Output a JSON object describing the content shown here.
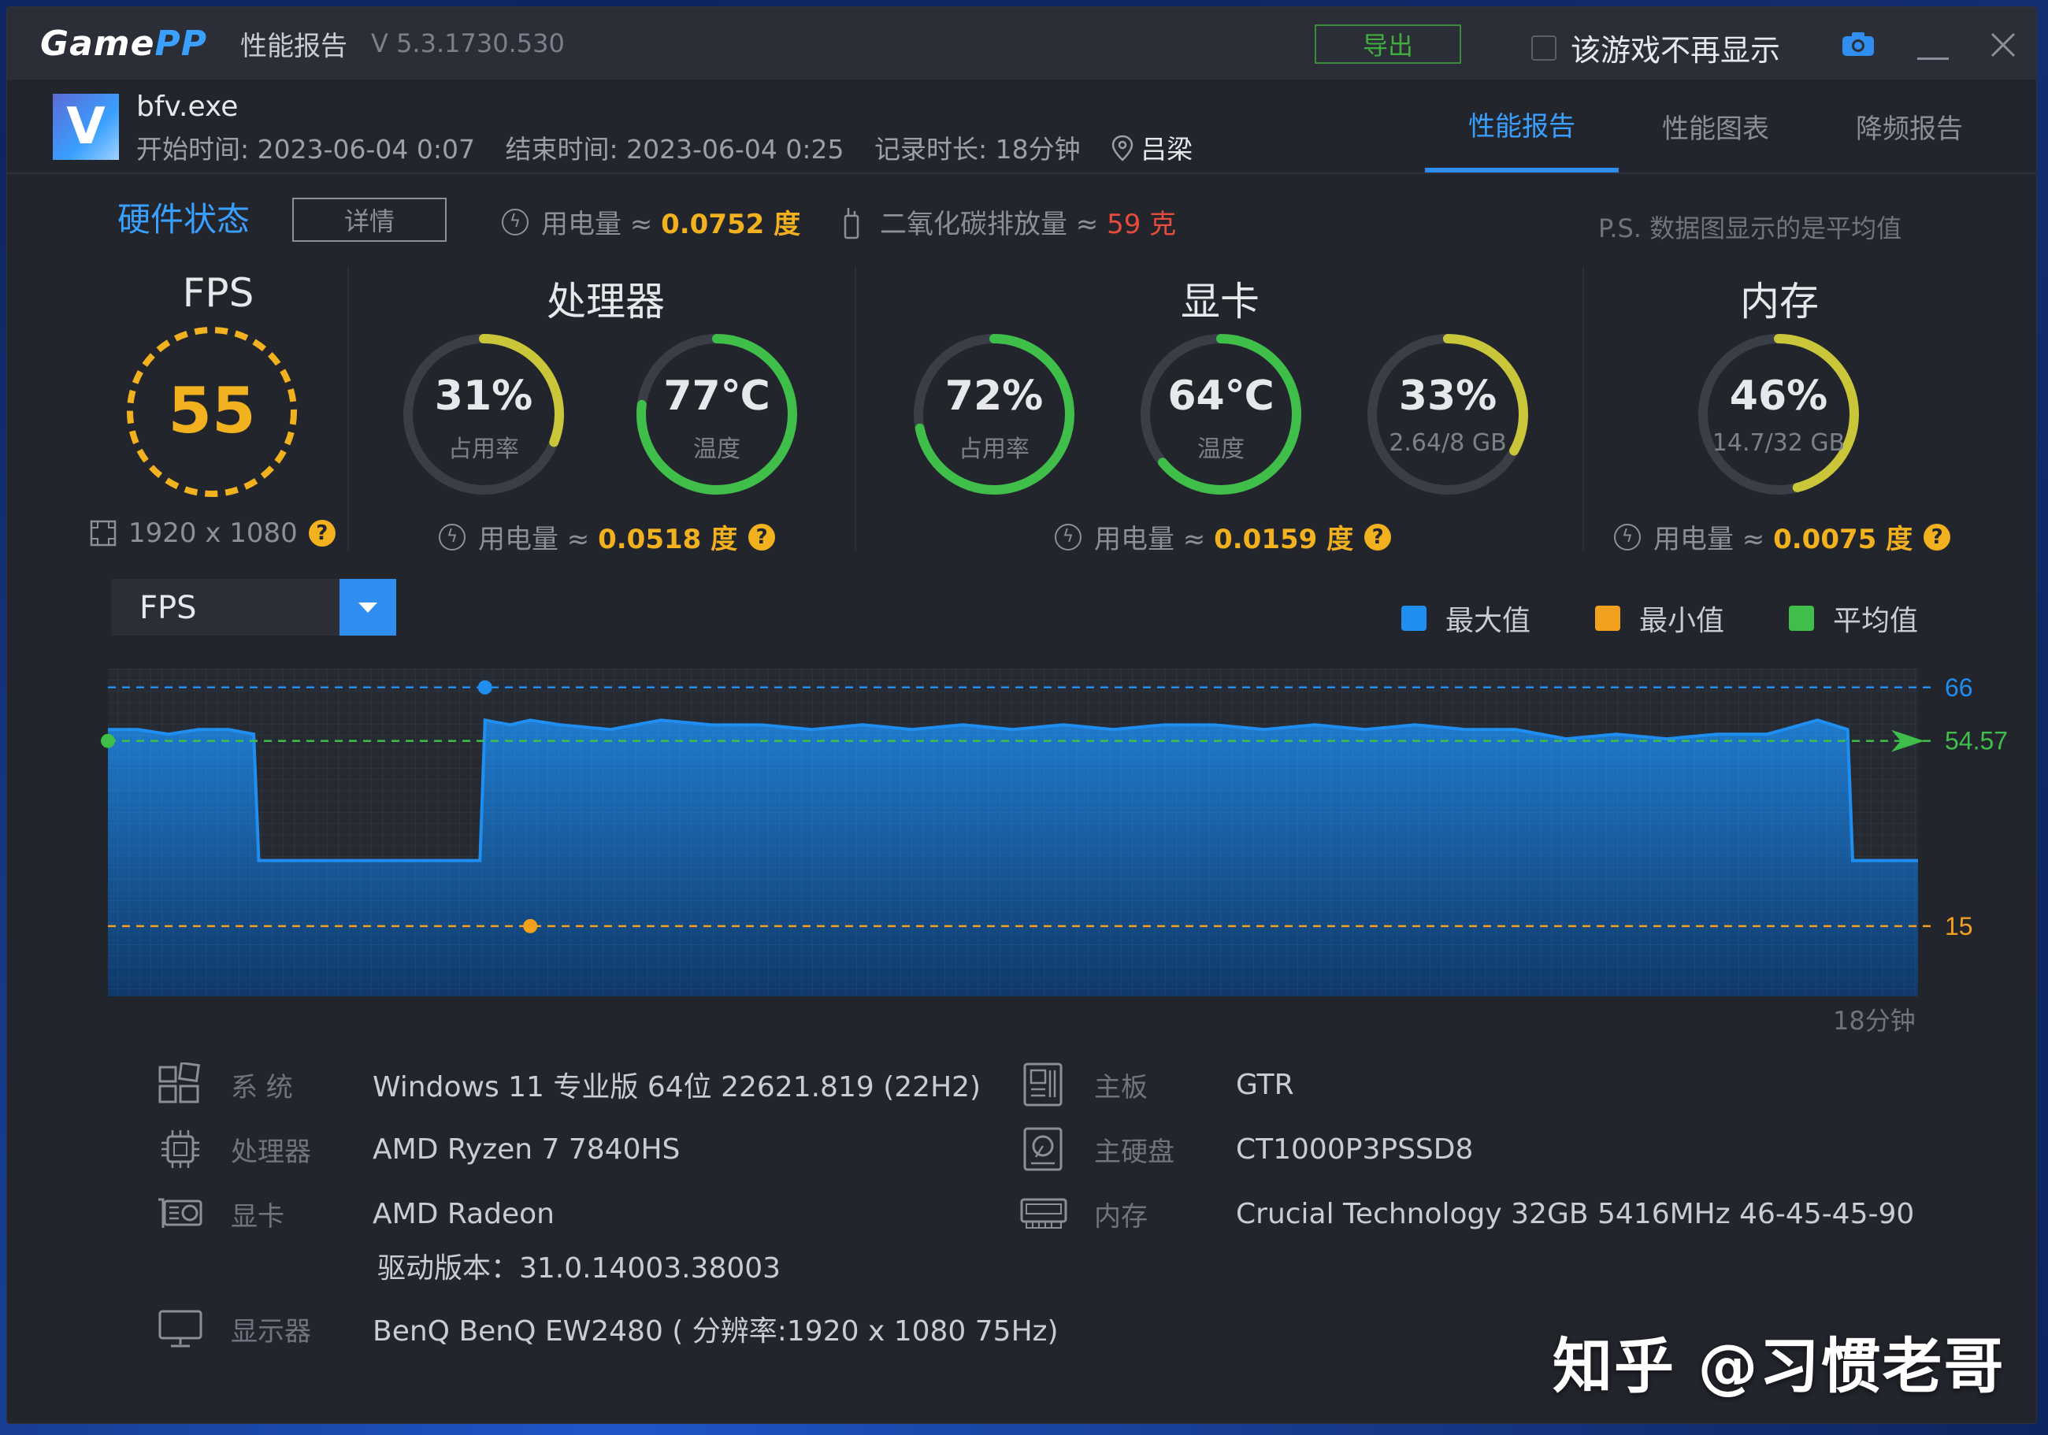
{
  "titlebar": {
    "logo_a": "Game",
    "logo_b": "PP",
    "report_title": "性能报告",
    "version": "V 5.3.1730.530",
    "export_label": "导出",
    "no_show_label": "该游戏不再显示"
  },
  "session": {
    "exe": "bfv.exe",
    "start": "开始时间: 2023-06-04 0:07",
    "end": "结束时间: 2023-06-04 0:25",
    "duration": "记录时长: 18分钟",
    "location": "吕梁"
  },
  "tabs": [
    {
      "label": "性能报告",
      "active": true
    },
    {
      "label": "性能图表",
      "active": false
    },
    {
      "label": "降频报告",
      "active": false
    }
  ],
  "hw": {
    "title": "硬件状态",
    "detail_label": "详情",
    "power_label": "用电量 ≈",
    "power_value": "0.0752 度",
    "co2_label": "二氧化碳排放量 ≈",
    "co2_value": "59 克",
    "ps": "P.S. 数据图显示的是平均值"
  },
  "fps": {
    "title": "FPS",
    "value": "55",
    "resolution": "1920 x 1080"
  },
  "cpu": {
    "title": "处理器",
    "usage": "31%",
    "usage_label": "占用率",
    "usage_frac": 0.31,
    "temp": "77℃",
    "temp_label": "温度",
    "temp_frac": 0.77,
    "power_label": "用电量 ≈",
    "power_value": "0.0518 度"
  },
  "gpu": {
    "title": "显卡",
    "usage": "72%",
    "usage_label": "占用率",
    "usage_frac": 0.72,
    "temp": "64℃",
    "temp_label": "温度",
    "temp_frac": 0.64,
    "mem": "33%",
    "mem_label": "2.64/8 GB",
    "mem_frac": 0.33,
    "power_label": "用电量 ≈",
    "power_value": "0.0159 度"
  },
  "ram": {
    "title": "内存",
    "usage": "46%",
    "usage_label": "14.7/32 GB",
    "usage_frac": 0.46,
    "power_label": "用电量 ≈",
    "power_value": "0.0075 度"
  },
  "chart_controls": {
    "metric": "FPS",
    "legend": [
      {
        "label": "最大值",
        "color": "#1f8ef0"
      },
      {
        "label": "最小值",
        "color": "#f2a01e"
      },
      {
        "label": "平均值",
        "color": "#3fbf4a"
      }
    ],
    "end_label": "18分钟"
  },
  "chart_data": {
    "type": "area",
    "xlabel": "",
    "ylabel": "",
    "x_unit": "minutes",
    "xlim": [
      0,
      18
    ],
    "ylim": [
      0,
      70
    ],
    "max": 66,
    "min": 15,
    "avg": 54.57,
    "max_label": "66",
    "min_label": "15",
    "avg_label": "54.57",
    "series": [
      {
        "color": "#1f8ef0",
        "x": [
          0.0,
          0.3,
          0.6,
          0.9,
          1.2,
          1.45,
          1.5,
          2.0,
          2.5,
          3.0,
          3.5,
          3.7,
          3.75,
          4.0,
          4.2,
          4.5,
          5.0,
          5.5,
          6.0,
          6.5,
          7.0,
          7.5,
          8.0,
          8.5,
          9.0,
          9.5,
          10.0,
          10.5,
          11.0,
          11.5,
          12.0,
          12.5,
          13.0,
          13.5,
          14.0,
          14.5,
          15.0,
          15.5,
          16.0,
          16.5,
          17.0,
          17.3,
          17.35,
          17.6,
          18.0
        ],
        "y": [
          57,
          57,
          56,
          57,
          57,
          56,
          29,
          29,
          29,
          29,
          29,
          29,
          59,
          58,
          59,
          58,
          57,
          59,
          58,
          58,
          57,
          58,
          57,
          58,
          57,
          58,
          57,
          58,
          58,
          57,
          58,
          57,
          58,
          57,
          57,
          55,
          56,
          55,
          56,
          56,
          59,
          57,
          29,
          29,
          29
        ]
      }
    ]
  },
  "system": [
    {
      "icon": "system-icon",
      "label": "系   统",
      "value": "Windows 11 专业版 64位 22621.819 (22H2)"
    },
    {
      "icon": "cpu-icon",
      "label": "处理器",
      "value": "AMD Ryzen 7 7840HS"
    },
    {
      "icon": "gpu-icon",
      "label": "显卡",
      "value": "AMD Radeon",
      "value2": "驱动版本：31.0.14003.38003"
    },
    {
      "icon": "monitor-icon",
      "label": "显示器",
      "value": "BenQ BenQ EW2480 ( 分辨率:1920 x 1080 75Hz)"
    },
    {
      "icon": "motherboard-icon",
      "label": "主板",
      "value": "GTR"
    },
    {
      "icon": "disk-icon",
      "label": "主硬盘",
      "value": "CT1000P3PSSD8"
    },
    {
      "icon": "ram-icon",
      "label": "内存",
      "value": "Crucial Technology 32GB 5416MHz 46-45-45-90"
    }
  ],
  "watermark": "知乎 @习惯老哥"
}
